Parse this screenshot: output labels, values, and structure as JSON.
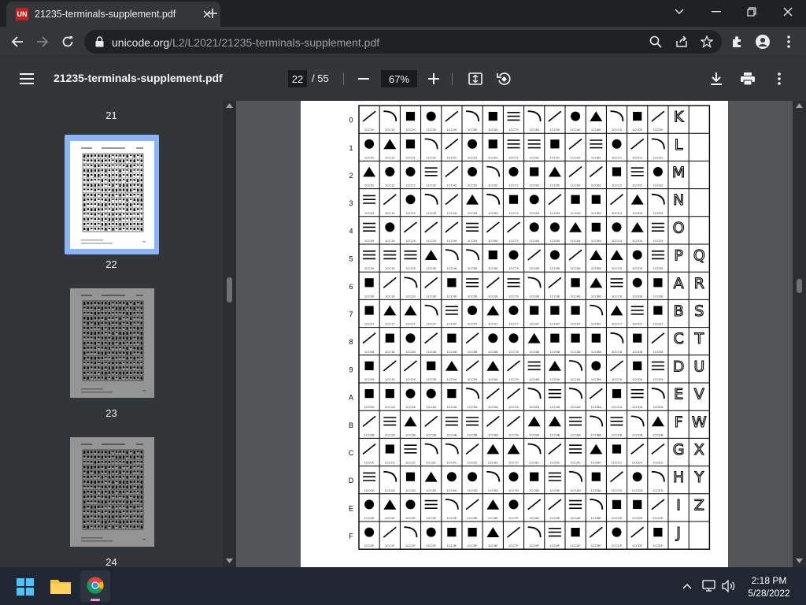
{
  "browser": {
    "tab_title": "21235-terminals-supplement.pdf",
    "favicon_text": "UN",
    "url_host": "unicode.org",
    "url_path": "/L2/L2021/21235-terminals-supplement.pdf"
  },
  "pdf": {
    "title": "21235-terminals-supplement.pdf",
    "current_page": "22",
    "total_pages": "/ 55",
    "zoom": "67%"
  },
  "sidebar": {
    "thumbnails": [
      {
        "label": "21"
      },
      {
        "label": "22",
        "selected": true
      },
      {
        "label": "23"
      },
      {
        "label": "24"
      }
    ]
  },
  "chart_table": {
    "row_labels": [
      "0",
      "1",
      "2",
      "3",
      "4",
      "5",
      "6",
      "7",
      "8",
      "9",
      "A",
      "B",
      "C",
      "D",
      "E",
      "F"
    ],
    "column_codes": [
      "1CC0",
      "1CC1",
      "1CC2",
      "1CC3",
      "1CC4",
      "1CC5",
      "1CC6",
      "1CC7",
      "1CC8",
      "1CC9",
      "1CCA",
      "1CCB",
      "1CCC",
      "1CCD",
      "1CCE"
    ],
    "letter_column_1": [
      "K",
      "L",
      "M",
      "N",
      "O",
      "P",
      "A",
      "B",
      "C",
      "D",
      "E",
      "F",
      "G",
      "H",
      "I",
      "J"
    ],
    "letter_column_2": [
      "",
      "",
      "",
      "",
      "",
      "Q",
      "R",
      "S",
      "T",
      "U",
      "V",
      "W",
      "X",
      "Y",
      "Z",
      ""
    ]
  },
  "taskbar": {
    "time": "2:18 PM",
    "date": "5/28/2022"
  },
  "colors": {
    "titlebar": "#202124",
    "toolbar": "#35363a",
    "pdf_toolbar": "#323639",
    "viewer_bg": "#525659",
    "selection": "#8ab4f8",
    "taskbar": "#1f2733"
  }
}
